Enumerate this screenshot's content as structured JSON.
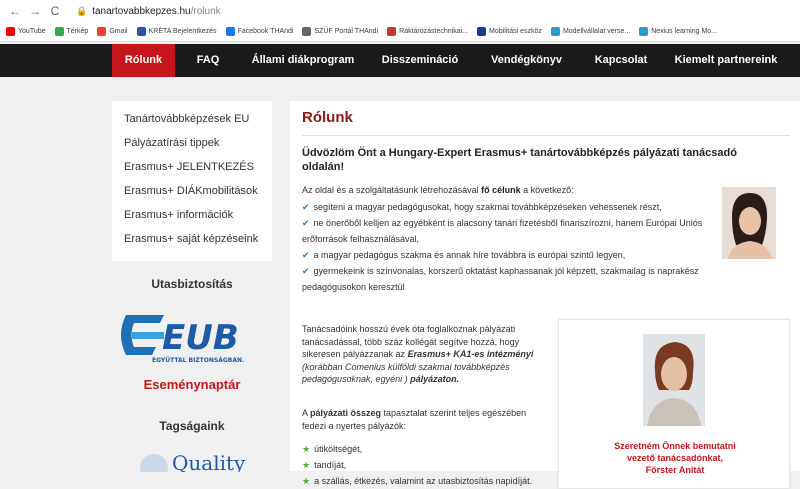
{
  "browser": {
    "back_icon": "←",
    "forward_icon": "→",
    "reload_icon": "C",
    "url_domain": "tanartovabbkepzes.hu",
    "url_path": "/rolunk",
    "bookmarks": [
      {
        "label": "YouTube",
        "icon_color": "#ff0000"
      },
      {
        "label": "Térkép",
        "icon_color": "#34a853"
      },
      {
        "label": "Gmail",
        "icon_color": "#ea4335"
      },
      {
        "label": "KRÉTA Bejelentkezés",
        "icon_color": "#2b5797"
      },
      {
        "label": "Facebook THAndi",
        "icon_color": "#1877f2"
      },
      {
        "label": "SZÜF Portál THAndi",
        "icon_color": "#666666"
      },
      {
        "label": "Raktározástechnikai...",
        "icon_color": "#c0392b"
      },
      {
        "label": "Mobilitási eszköz",
        "icon_color": "#1a3c8f"
      },
      {
        "label": "Modellvállalat verse...",
        "icon_color": "#2b9bd1"
      },
      {
        "label": "Nexius learning Mo...",
        "icon_color": "#2b9bd1"
      }
    ]
  },
  "nav": {
    "items": [
      "Rólunk",
      "FAQ",
      "Állami diákprogram",
      "Disszemináció",
      "Vendégkönyv",
      "Kapcsolat",
      "Kiemelt partnereink"
    ]
  },
  "sidebar": {
    "menu": [
      "Tanártovábbképzések EU",
      "Pályázatírási tippek",
      "Erasmus+ JELENTKEZÉS",
      "Erasmus+ DIÁKmobilitások",
      "Erasmus+ információk",
      "Erasmus+ saját képzéseink"
    ],
    "travel_insurance_title": "Utasbiztosítás",
    "eub_logo_text": "EUB",
    "eub_tagline": "EGYÜTTAL BIZTONSÁGBAN.",
    "calendar_title": "Eseménynaptár",
    "memberships_title": "Tagságaink",
    "quality_text": "Quality"
  },
  "main": {
    "title": "Rólunk",
    "greeting": "Üdvözlöm Önt a Hungary-Expert Erasmus+ tanártovábbképzés pályázati tanácsadó oldalán!",
    "intro_pre": "Az oldal és a szolgáltatásunk létrehozásával ",
    "intro_bold": "fő célunk",
    "intro_post": " a következő:",
    "bullets": [
      "segíteni a magyar pedagógusokat, hogy szakmai továbbképzéseken vehessenek részt,",
      "ne önerőből kelljen az egyébként is alacsony tanári fizetésből finanszírozni, hanem Európai Uniós erőforrások felhasználásával,",
      "a magyar pedagógus szakma és annak híre továbbra is európai szintű legyen,",
      "gyermekeink is színvonalas, korszerű oktatást kaphassanak jól képzett, szakmailag is naprakész pedagógusokon keresztül"
    ],
    "para2_a": "Tanácsadóink hosszú évek óta foglalkoznak pályázati tanácsadással, több száz kollégát segítve hozzá, hogy sikeresen pályázzanak az ",
    "para2_b": "Erasmus+ KA1-es intézményi",
    "para2_c": " (korábban Comenius külföldi szakmai továbbképzés pedagógusoknak, egyéni )",
    "para2_d": " pályázaton.",
    "para3_a": "A ",
    "para3_b": "pályázati összeg",
    "para3_c": " tapasztalat szerint teljes egészében fedezi a nyertes pályázók:",
    "list2": [
      "útiköltségét,",
      "tandíját,",
      "a szállás, étkezés, valamint az utasbiztosítás napidíját."
    ],
    "card_line1": "Szeretném Önnek bemutatni",
    "card_line2": "vezető tanácsadónkat,",
    "card_line3": "Förster Anitát"
  },
  "colors": {
    "accent": "#c4161c",
    "nav_bg": "#1a1a1a",
    "title": "#8b1a1a"
  }
}
